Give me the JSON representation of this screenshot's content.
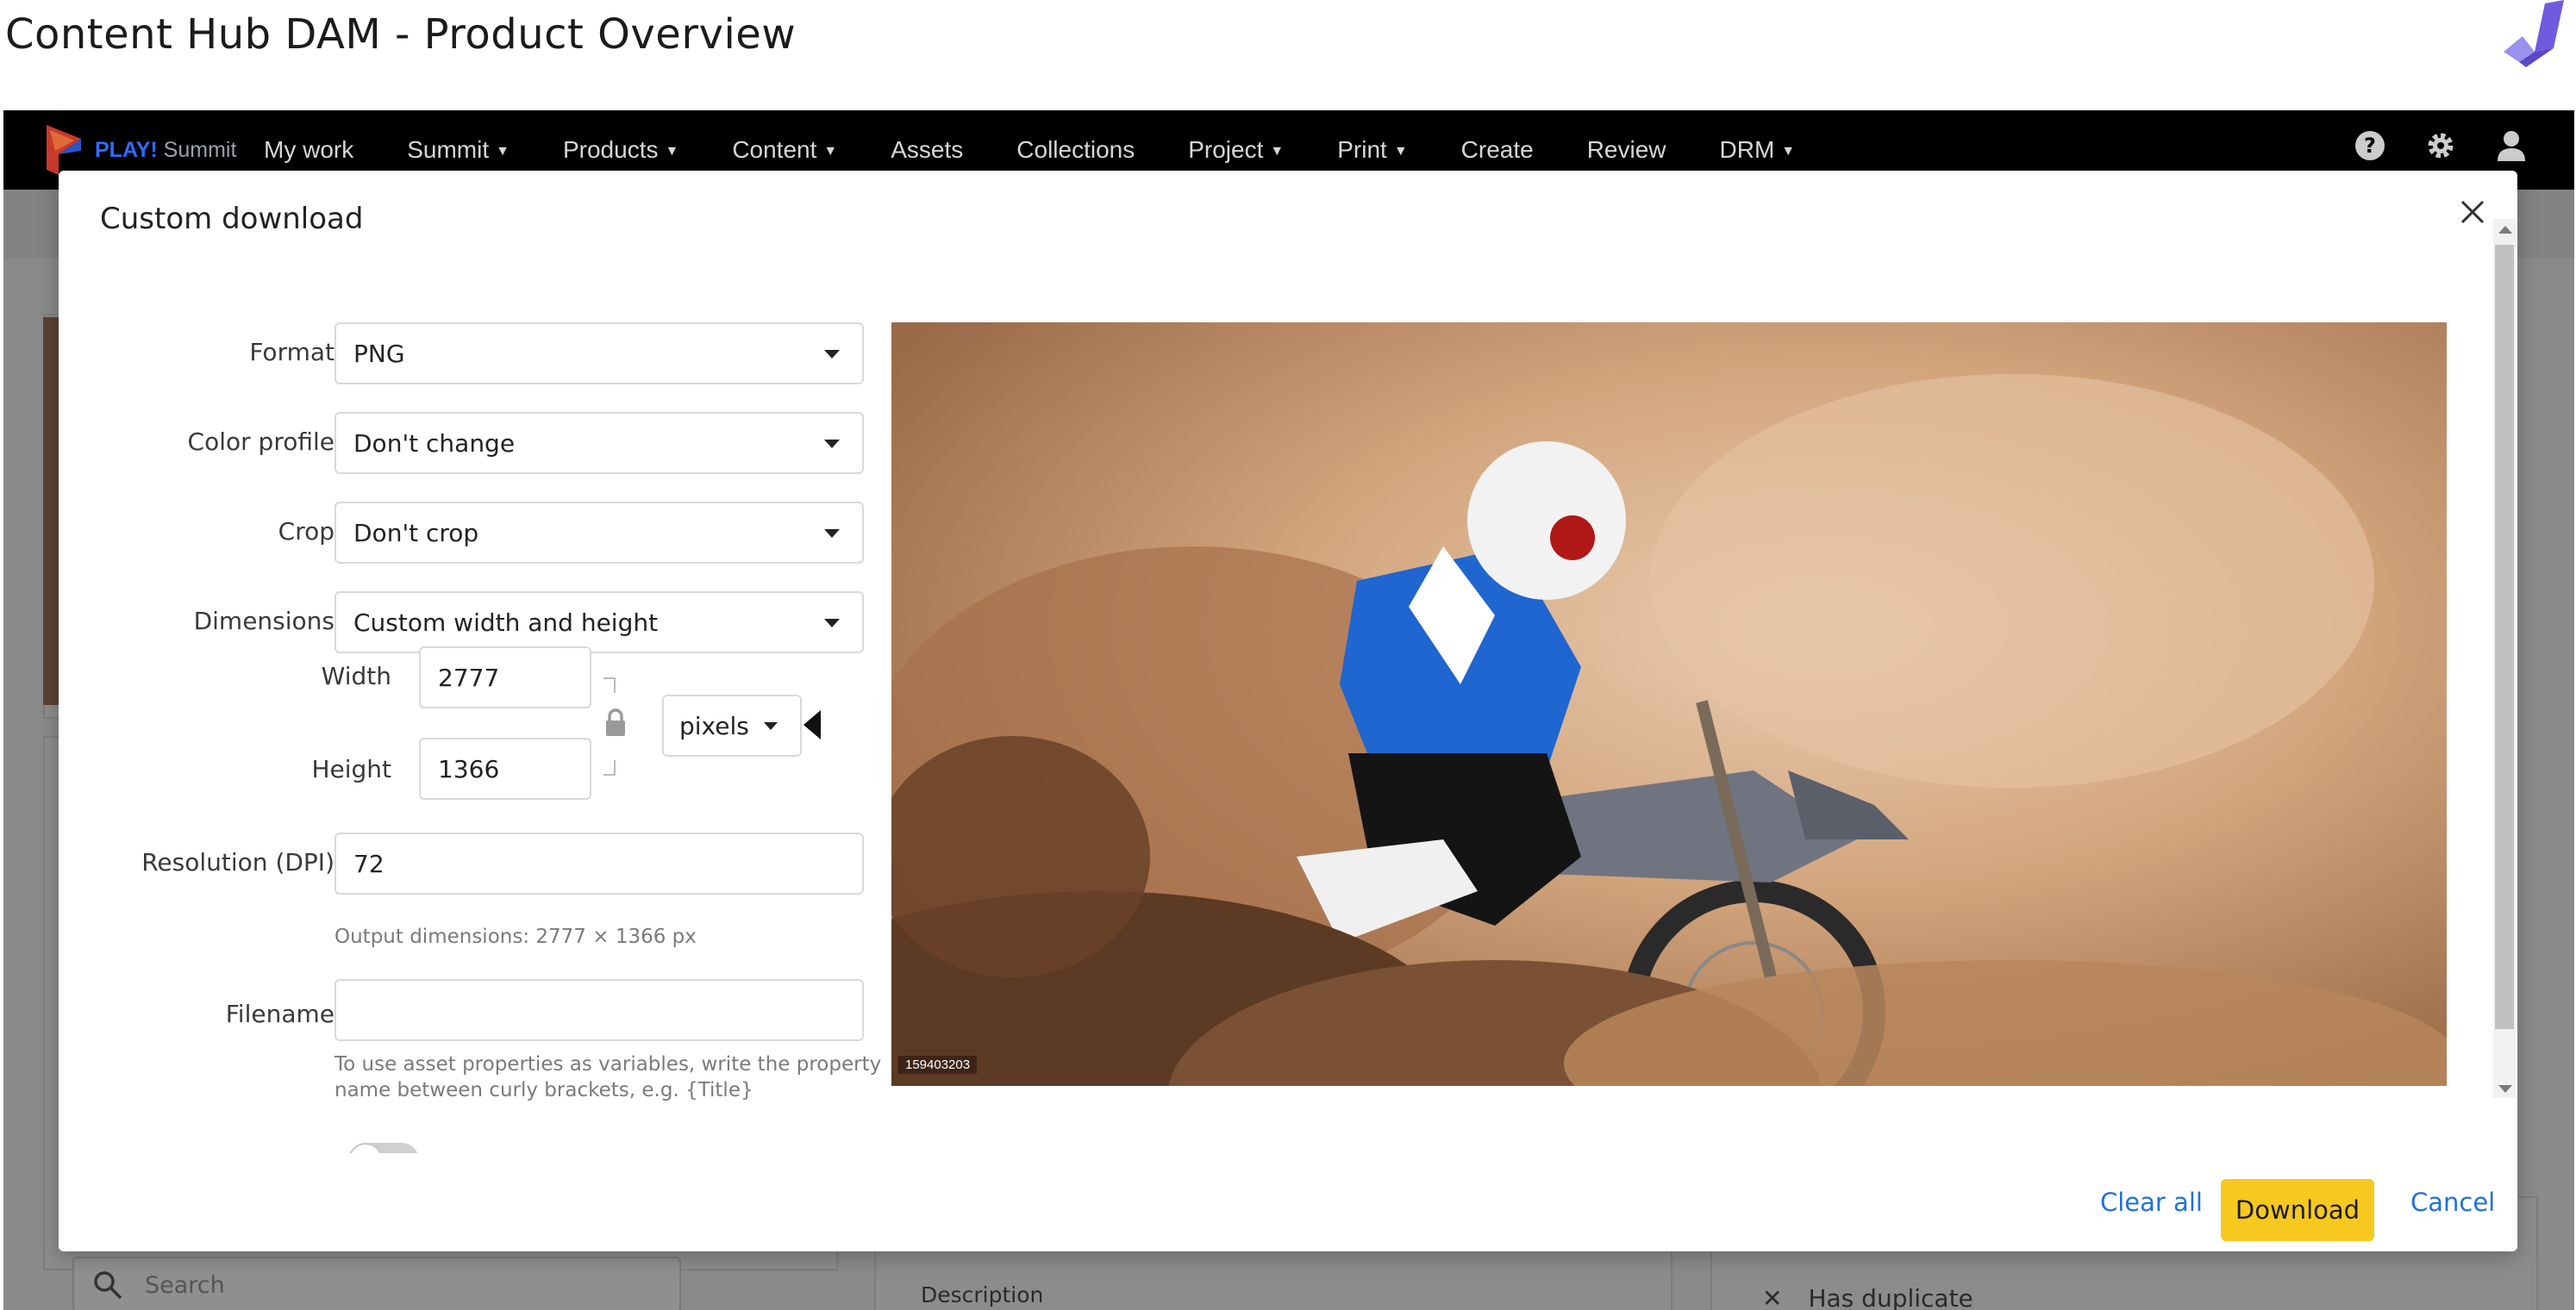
{
  "page": {
    "title": "Content Hub DAM - Product Overview"
  },
  "navbar": {
    "brand_play": "PLAY!",
    "brand_name": "Summit",
    "items": [
      {
        "label": "My work",
        "dropdown": false
      },
      {
        "label": "Summit",
        "dropdown": true
      },
      {
        "label": "Products",
        "dropdown": true
      },
      {
        "label": "Content",
        "dropdown": true
      },
      {
        "label": "Assets",
        "dropdown": false
      },
      {
        "label": "Collections",
        "dropdown": false
      },
      {
        "label": "Project",
        "dropdown": true
      },
      {
        "label": "Print",
        "dropdown": true
      },
      {
        "label": "Create",
        "dropdown": false
      },
      {
        "label": "Review",
        "dropdown": false
      },
      {
        "label": "DRM",
        "dropdown": true
      }
    ],
    "icons": [
      "help-icon",
      "gear-icon",
      "user-icon"
    ]
  },
  "background": {
    "search_placeholder": "Search",
    "description_label": "Description",
    "has_duplicate_label": "Has duplicate"
  },
  "modal": {
    "title": "Custom download",
    "fields": {
      "format": {
        "label": "Format",
        "value": "PNG"
      },
      "color_profile": {
        "label": "Color profile",
        "value": "Don't change"
      },
      "crop": {
        "label": "Crop",
        "value": "Don't crop"
      },
      "dimensions": {
        "label": "Dimensions",
        "value": "Custom width and height"
      },
      "width": {
        "label": "Width",
        "value": "2777"
      },
      "height": {
        "label": "Height",
        "value": "1366"
      },
      "unit": {
        "value": "pixels"
      },
      "resolution": {
        "label": "Resolution (DPI)",
        "value": "72"
      },
      "output_dimensions": "Output dimensions: 2777 × 1366 px",
      "filename": {
        "label": "Filename",
        "value": "",
        "hint": "To use asset properties as variables, write the property name between curly brackets, e.g. {Title}"
      }
    },
    "preview": {
      "asset_id": "159403203"
    },
    "footer": {
      "clear_all": "Clear all",
      "download": "Download",
      "cancel": "Cancel"
    }
  },
  "colors": {
    "accent_button": "#f7c81e",
    "link": "#1f72d8",
    "navbar_bg": "#000000",
    "brand_blue": "#2e6cff"
  }
}
